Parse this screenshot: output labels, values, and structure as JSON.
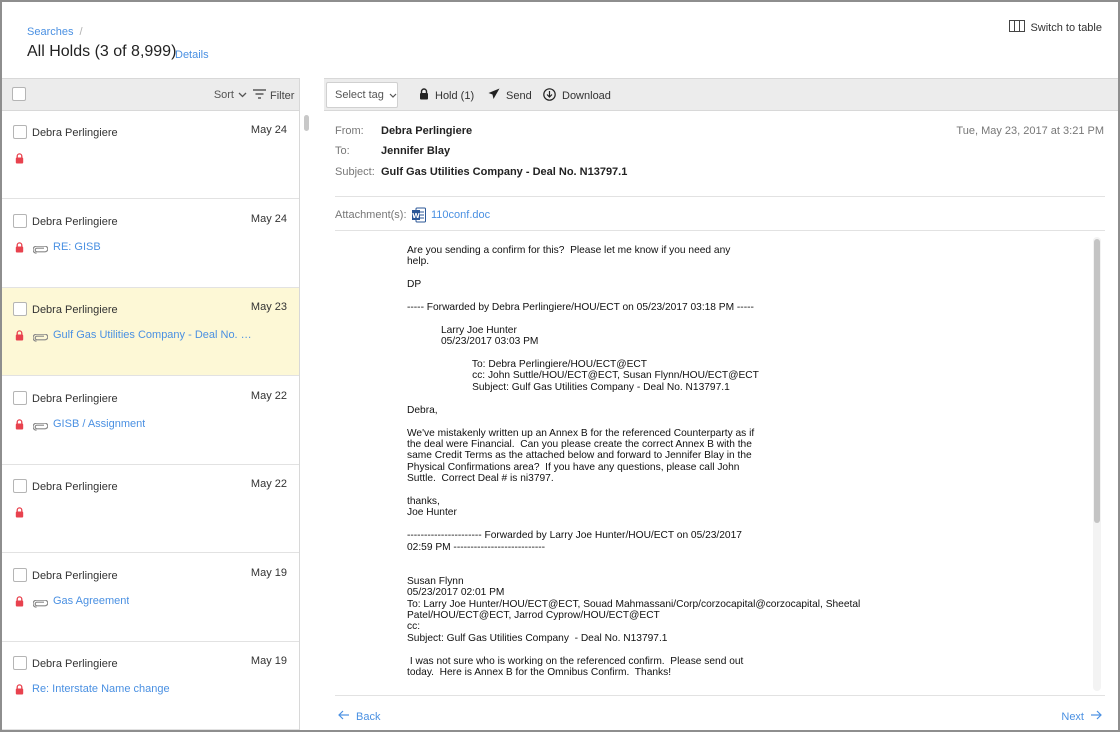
{
  "header": {
    "breadcrumb": "Searches",
    "breadcrumb_sep": "/",
    "title": "All Holds (3 of 8,999)",
    "details_label": "Details",
    "switch_label": "Switch to table"
  },
  "list_toolbar": {
    "sort_label": "Sort",
    "filter_label": "Filter"
  },
  "list": [
    {
      "sender": "Debra Perlingiere",
      "date": "May 24",
      "subject": "",
      "attachment": false
    },
    {
      "sender": "Debra Perlingiere",
      "date": "May 24",
      "subject": "RE: GISB",
      "attachment": true
    },
    {
      "sender": "Debra Perlingiere",
      "date": "May 23",
      "subject": "Gulf Gas Utilities Company - Deal No. N...",
      "attachment": true
    },
    {
      "sender": "Debra Perlingiere",
      "date": "May 22",
      "subject": "GISB / Assignment",
      "attachment": true
    },
    {
      "sender": "Debra Perlingiere",
      "date": "May 22",
      "subject": "",
      "attachment": false
    },
    {
      "sender": "Debra Perlingiere",
      "date": "May 19",
      "subject": "Gas Agreement",
      "attachment": true
    },
    {
      "sender": "Debra Perlingiere",
      "date": "May 19",
      "subject": "Re: Interstate Name change",
      "attachment": false
    }
  ],
  "toolbar": {
    "select_tag": "Select tag",
    "hold": "Hold (1)",
    "send": "Send",
    "download": "Download"
  },
  "message": {
    "from_label": "From:",
    "from": "Debra Perlingiere",
    "to_label": "To:",
    "to": "Jennifer Blay",
    "subject_label": "Subject:",
    "subject": "Gulf Gas Utilities Company - Deal No. N13797.1",
    "date": "Tue, May 23, 2017 at 3:21 PM",
    "attachments_label": "Attachment(s):",
    "attachment": "110conf.doc",
    "body_lines": [
      "Are you sending a confirm for this?  Please let me know if you need any",
      "help.",
      "",
      "DP",
      "",
      "----- Forwarded by Debra Perlingiere/HOU/ECT on 05/23/2017 03:18 PM -----",
      "",
      "            Larry Joe Hunter",
      "            05/23/2017 03:03 PM",
      "",
      "                       To: Debra Perlingiere/HOU/ECT@ECT",
      "                       cc: John Suttle/HOU/ECT@ECT, Susan Flynn/HOU/ECT@ECT",
      "                       Subject: Gulf Gas Utilities Company - Deal No. N13797.1",
      "",
      "Debra,",
      "",
      "We've mistakenly written up an Annex B for the referenced Counterparty as if",
      "the deal were Financial.  Can you please create the correct Annex B with the",
      "same Credit Terms as the attached below and forward to Jennifer Blay in the",
      "Physical Confirmations area?  If you have any questions, please call John",
      "Suttle.  Correct Deal # is ni3797.",
      "",
      "thanks,",
      "Joe Hunter",
      "",
      "---------------------- Forwarded by Larry Joe Hunter/HOU/ECT on 05/23/2017",
      "02:59 PM ---------------------------",
      "",
      "",
      "Susan Flynn",
      "05/23/2017 02:01 PM",
      "To: Larry Joe Hunter/HOU/ECT@ECT, Souad Mahmassani/Corp/corzocapital@corzocapital, Sheetal",
      "Patel/HOU/ECT@ECT, Jarrod Cyprow/HOU/ECT@ECT",
      "cc:",
      "Subject: Gulf Gas Utilities Company  - Deal No. N13797.1",
      "",
      " I was not sure who is working on the referenced confirm.  Please send out",
      "today.  Here is Annex B for the Omnibus Confirm.  Thanks!"
    ]
  },
  "nav": {
    "back": "Back",
    "next": "Next"
  },
  "colors": {
    "link": "#4a90e2",
    "lock": "#e8424e",
    "selected_row": "#fdf8d6",
    "toolbar_bg": "#ececec"
  },
  "icons": {
    "lock": "lock-icon",
    "attachment": "paperclip-icon",
    "table": "table-icon",
    "filter": "filter-icon",
    "send": "send-icon",
    "download": "download-icon",
    "word": "word-doc-icon"
  }
}
